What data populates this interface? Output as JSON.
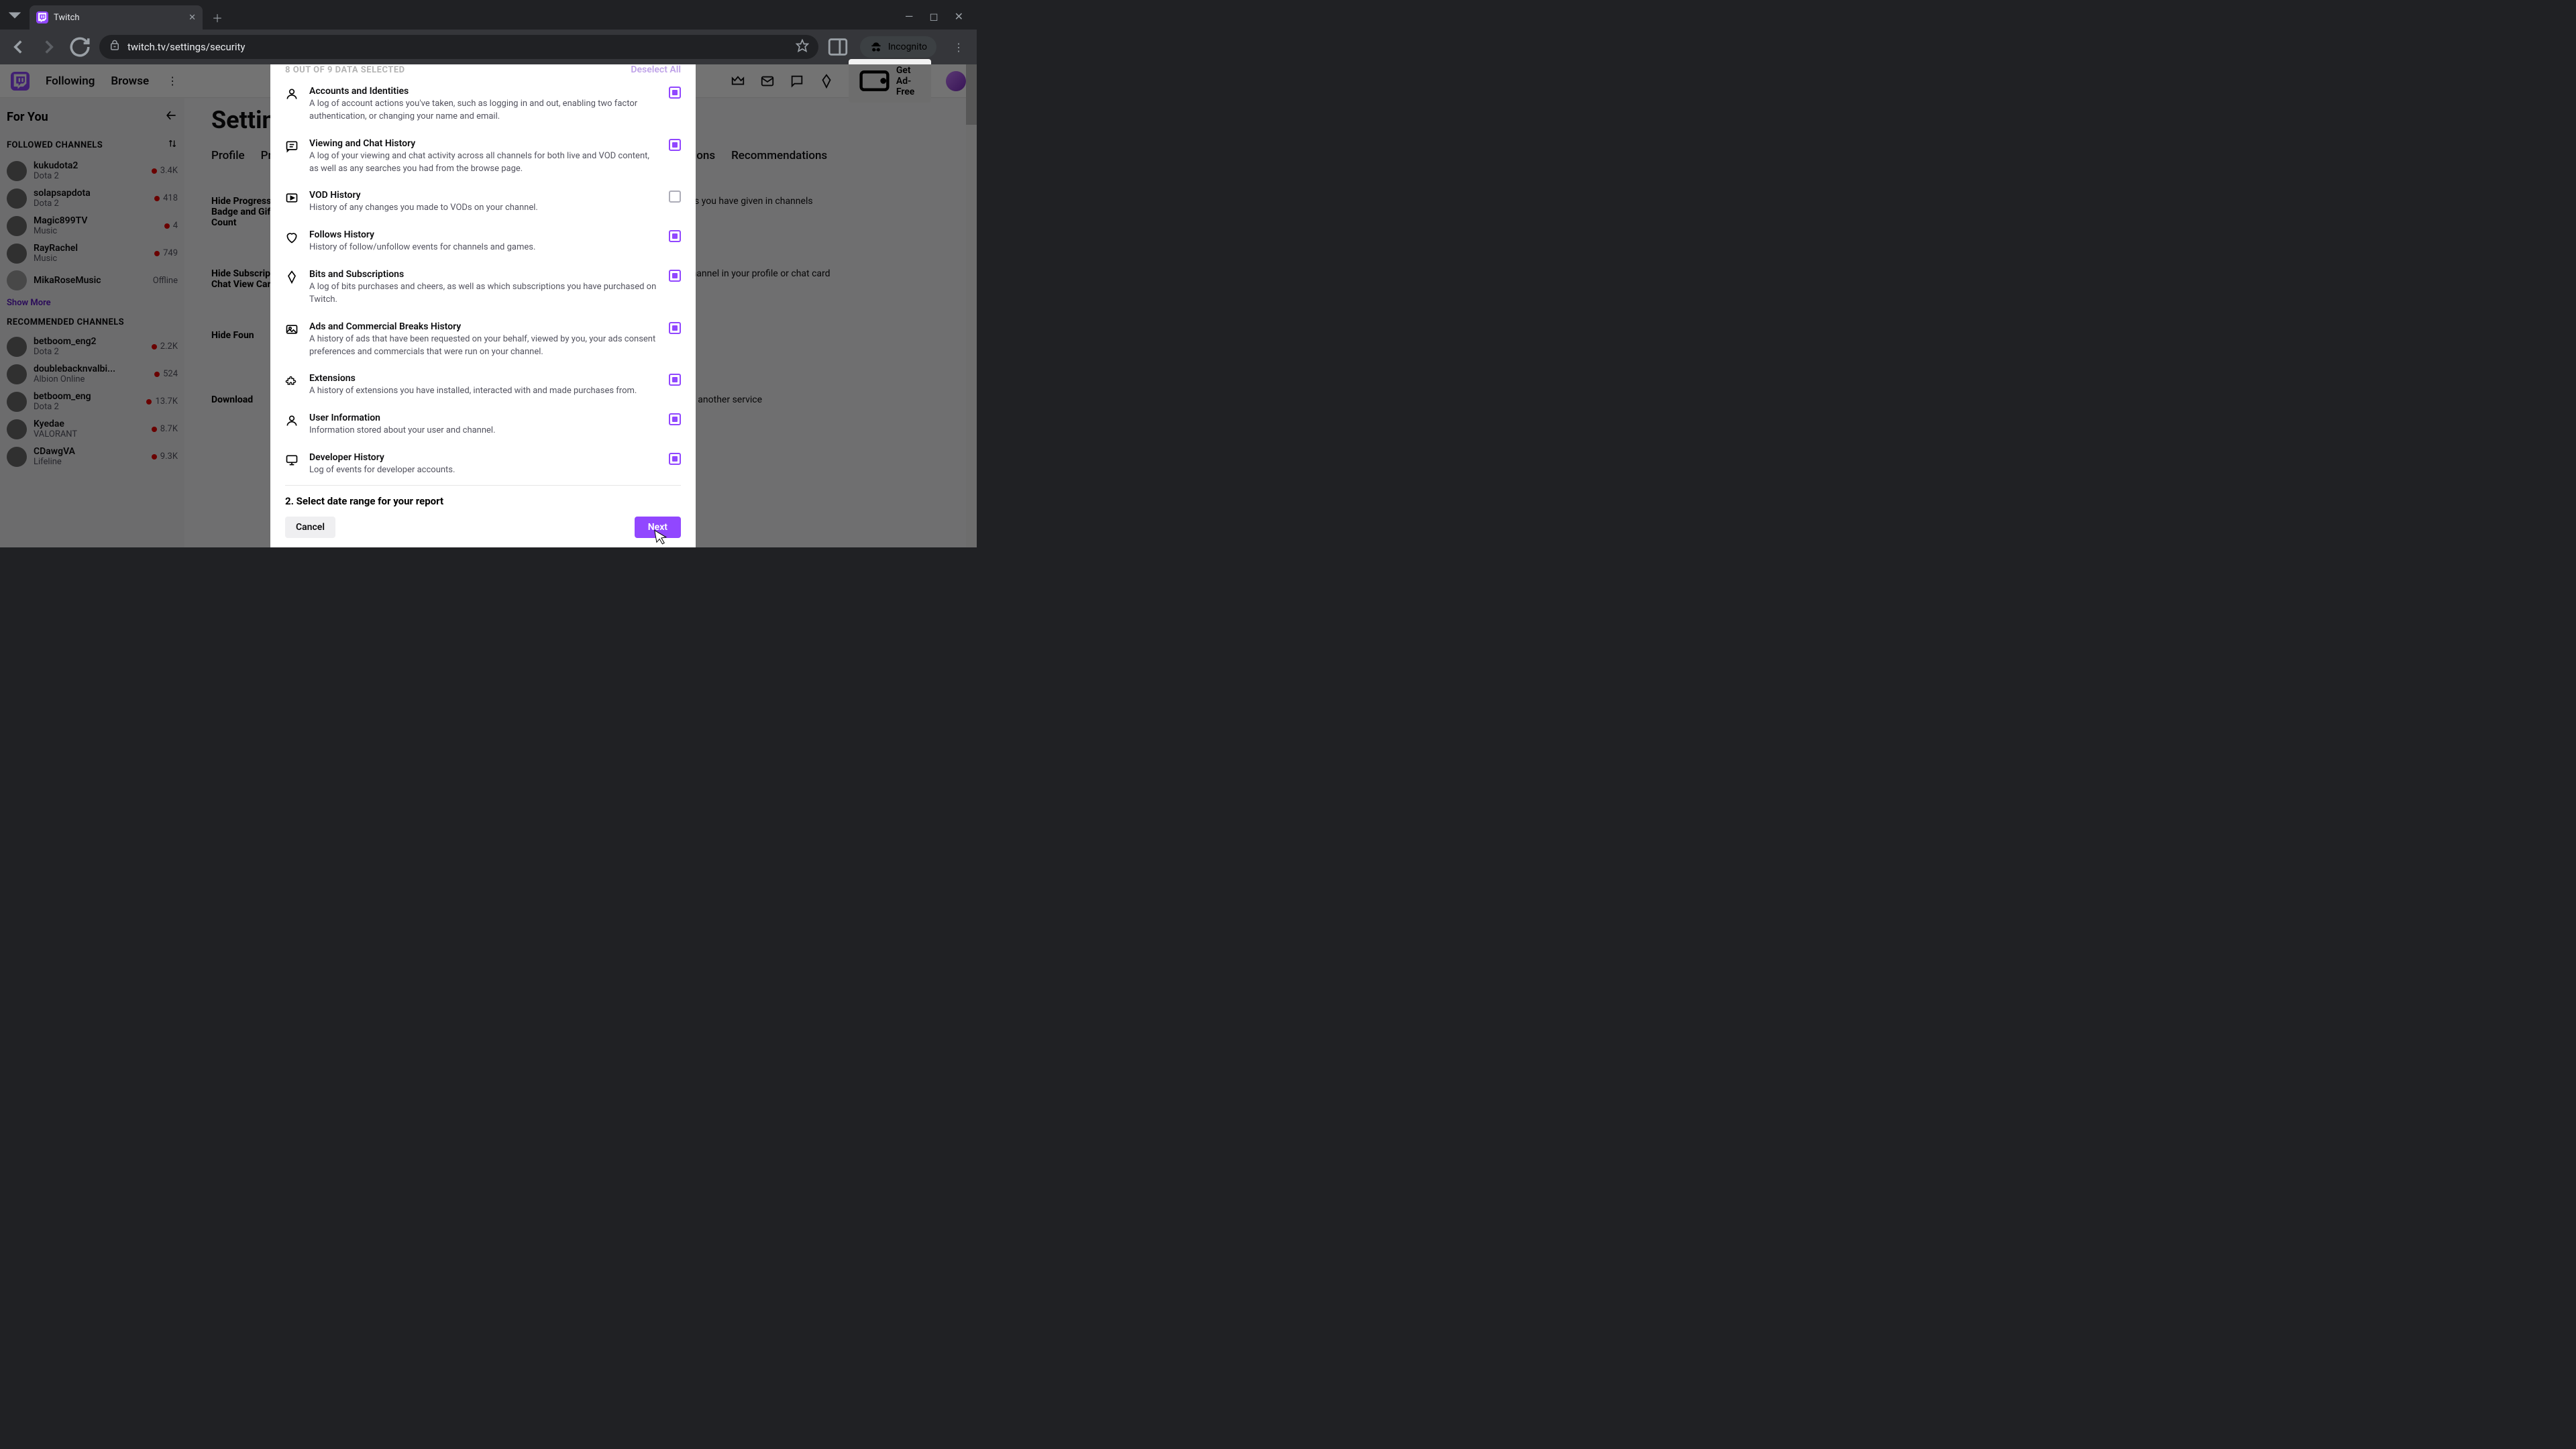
{
  "browser": {
    "tab_title": "Twitch",
    "url": "twitch.tv/settings/security",
    "incognito_label": "Incognito"
  },
  "nav": {
    "following": "Following",
    "browse": "Browse",
    "ad_free": "Get Ad-Free"
  },
  "sidebar": {
    "for_you": "For You",
    "followed_title": "FOLLOWED CHANNELS",
    "recommended_title": "RECOMMENDED CHANNELS",
    "show_more": "Show More",
    "followed": [
      {
        "name": "kukudota2",
        "game": "Dota 2",
        "views": "3.4K",
        "live": true
      },
      {
        "name": "solapsapdota",
        "game": "Dota 2",
        "views": "418",
        "live": true
      },
      {
        "name": "Magic899TV",
        "game": "Music",
        "views": "4",
        "live": true
      },
      {
        "name": "RayRachel",
        "game": "Music",
        "views": "749",
        "live": true
      },
      {
        "name": "MikaRoseMusic",
        "game": "",
        "views": "Offline",
        "live": false
      }
    ],
    "recommended": [
      {
        "name": "betboom_eng2",
        "game": "Dota 2",
        "views": "2.2K",
        "live": true
      },
      {
        "name": "doublebacknvalbi...",
        "game": "Albion Online",
        "views": "524",
        "live": true
      },
      {
        "name": "betboom_eng",
        "game": "Dota 2",
        "views": "13.7K",
        "live": true
      },
      {
        "name": "Kyedae",
        "game": "VALORANT",
        "views": "8.7K",
        "live": true
      },
      {
        "name": "CDawgVA",
        "game": "Lifeline",
        "views": "9.3K",
        "live": true
      }
    ]
  },
  "main": {
    "title": "Settings",
    "tabs": [
      "Profile",
      "Pri",
      "ions",
      "Recommendations"
    ],
    "row1_label": "Hide Progressive Gifter Badge and Gifts Given Count",
    "row1_desc": "s you have given in channels",
    "row2_label": "Hide Subscription Status in Chat View Card",
    "row2_desc": "r channel in your profile or chat card",
    "row3_label": "Hide Foun",
    "row4_label": "Download",
    "row4_desc": "or use it with another service"
  },
  "modal": {
    "selected_text": "8 OUT OF 9 DATA SELECTED",
    "deselect": "Deselect All",
    "items": [
      {
        "title": "Accounts and Identities",
        "desc": "A log of account actions you've taken, such as logging in and out, enabling two factor authentication, or changing your name and email.",
        "checked": true,
        "icon": "person"
      },
      {
        "title": "Viewing and Chat History",
        "desc": "A log of your viewing and chat activity across all channels for both live and VOD content, as well as any searches you had from the browse page.",
        "checked": true,
        "icon": "chat"
      },
      {
        "title": "VOD History",
        "desc": "History of any changes you made to VODs on your channel.",
        "checked": false,
        "icon": "video"
      },
      {
        "title": "Follows History",
        "desc": "History of follow/unfollow events for channels and games.",
        "checked": true,
        "icon": "heart"
      },
      {
        "title": "Bits and Subscriptions",
        "desc": "A log of bits purchases and cheers, as well as which subscriptions you have purchased on Twitch.",
        "checked": true,
        "icon": "bits"
      },
      {
        "title": "Ads and Commercial Breaks History",
        "desc": "A history of ads that have been requested on your behalf, viewed by you, your ads consent preferences and commercials that were run on your channel.",
        "checked": true,
        "icon": "image"
      },
      {
        "title": "Extensions",
        "desc": "A history of extensions you have installed, interacted with and made purchases from.",
        "checked": true,
        "icon": "puzzle"
      },
      {
        "title": "User Information",
        "desc": "Information stored about your user and channel.",
        "checked": true,
        "icon": "person"
      },
      {
        "title": "Developer History",
        "desc": "Log of events for developer accounts.",
        "checked": true,
        "icon": "monitor"
      }
    ],
    "step2": "2. Select date range for your report",
    "cancel": "Cancel",
    "next": "Next"
  }
}
